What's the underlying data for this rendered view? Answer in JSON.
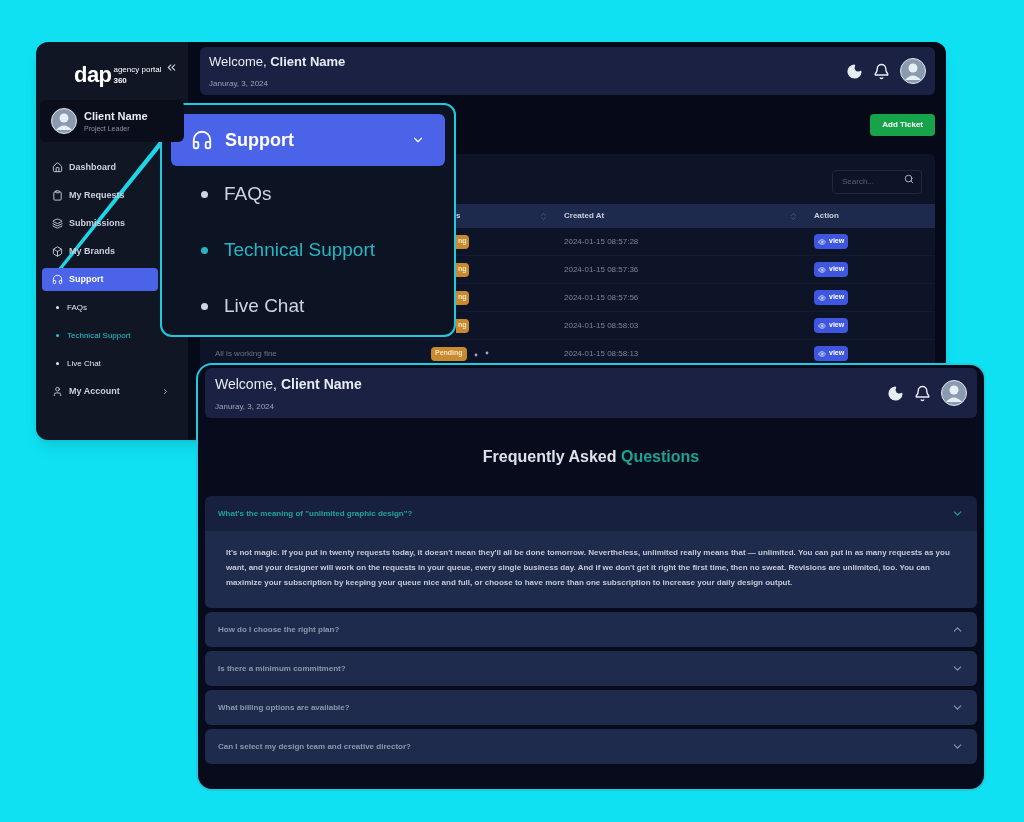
{
  "back_window": {
    "logo": {
      "word": "dap",
      "tagline": "agency portal",
      "number": "360"
    },
    "profile": {
      "name": "Client Name",
      "role": "Project Leader"
    },
    "nav": [
      {
        "label": "Dashboard",
        "selected": false
      },
      {
        "label": "My Requests",
        "selected": false
      },
      {
        "label": "Submissions",
        "selected": false
      },
      {
        "label": "My Brands",
        "selected": false
      },
      {
        "label": "Support",
        "selected": true,
        "children": [
          {
            "label": "FAQs",
            "selected": false
          },
          {
            "label": "Technical Support",
            "selected": true
          },
          {
            "label": "Live Chat",
            "selected": false
          }
        ]
      },
      {
        "label": "My Account",
        "selected": false,
        "has_arrow": true
      }
    ],
    "header": {
      "greeting": "Welcome,",
      "name": "Client Name",
      "date": "Januray, 3, 2024"
    },
    "add_button": "Add Ticket",
    "search": {
      "placeholder": "Search..."
    },
    "columns": [
      {
        "label": "s",
        "sortable": true
      },
      {
        "label": "Created At",
        "sortable": true
      },
      {
        "label": "Action",
        "sortable": false
      }
    ],
    "rows": [
      {
        "title": "",
        "status": "ng",
        "clipped": true,
        "created_at": "2024-01-15 08:57:28",
        "action": "view"
      },
      {
        "title": "",
        "status": "ng",
        "clipped": true,
        "created_at": "2024-01-15 08:57:36",
        "action": "view"
      },
      {
        "title": "",
        "status": "ng",
        "clipped": true,
        "created_at": "2024-01-15 08:57:56",
        "action": "view"
      },
      {
        "title": "",
        "status": "ng",
        "clipped": true,
        "created_at": "2024-01-15 08:58:03",
        "action": "view"
      },
      {
        "title": "All is working fine",
        "status": "Pending",
        "clipped": false,
        "created_at": "2024-01-15 08:58:13",
        "action": "view"
      }
    ]
  },
  "zoom_callout": {
    "header": "Support",
    "items": [
      {
        "label": "FAQs",
        "selected": false
      },
      {
        "label": "Technical Support",
        "selected": true
      },
      {
        "label": "Live Chat",
        "selected": false
      }
    ]
  },
  "front_window": {
    "header": {
      "greeting": "Welcome,",
      "name": "Client Name",
      "date": "Januray, 3, 2024"
    },
    "title": "Frequently Asked",
    "title_highlight": "Questions",
    "faqs": [
      {
        "question": "What's the meaning of \"unlimited graphic design\"?",
        "expanded": true,
        "pointing_up": false,
        "answer": "It's not magic. If you put in twenty requests today, it doesn't mean they'll all be done tomorrow. Nevertheless, unlimited really means that — unlimited. You can put in as many requests as you want, and your designer will work on the requests in your queue, every single business day. And if we don't get it right the first time, then no sweat. Revisions are unlimited, too. You can maximize your subscription by keeping your queue nice and full, or choose to have more than one subscription to increase your daily design output."
      },
      {
        "question": "How do I choose the right plan?",
        "expanded": false,
        "pointing_up": true
      },
      {
        "question": "Is there a minimum commitment?",
        "expanded": false,
        "pointing_up": false
      },
      {
        "question": "What billing options are available?",
        "expanded": false,
        "pointing_up": false
      },
      {
        "question": "Can I select my design team and creative director?",
        "expanded": false,
        "pointing_up": false
      }
    ]
  }
}
